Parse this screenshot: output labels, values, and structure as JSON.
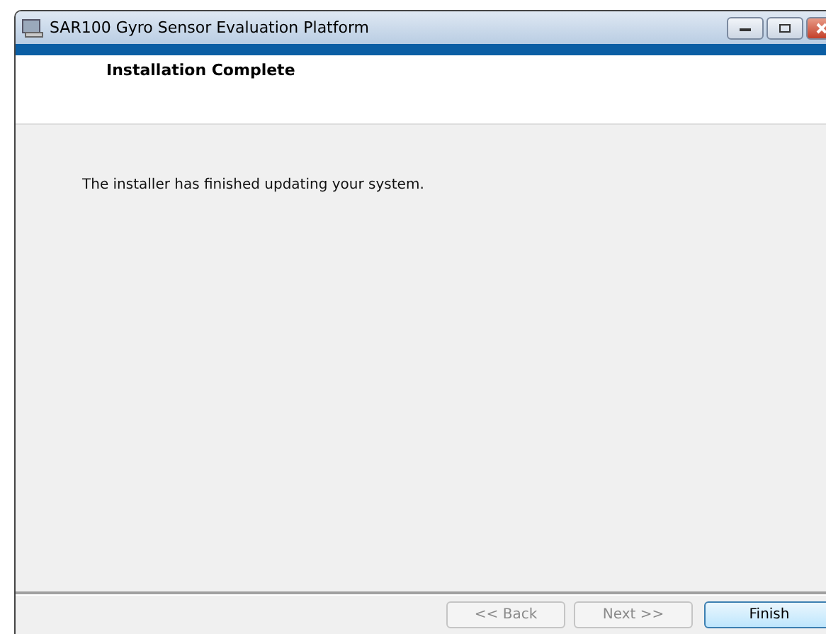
{
  "window": {
    "title": "SAR100 Gyro Sensor Evaluation Platform"
  },
  "header": {
    "title": "Installation Complete"
  },
  "body": {
    "message": "The installer has finished updating your system."
  },
  "buttons": [
    {
      "label": "<< Back",
      "disabled": true,
      "kind": "nav"
    },
    {
      "label": "Next >>",
      "disabled": true,
      "kind": "nav"
    },
    {
      "label": "Finish",
      "disabled": false,
      "kind": "default"
    }
  ]
}
